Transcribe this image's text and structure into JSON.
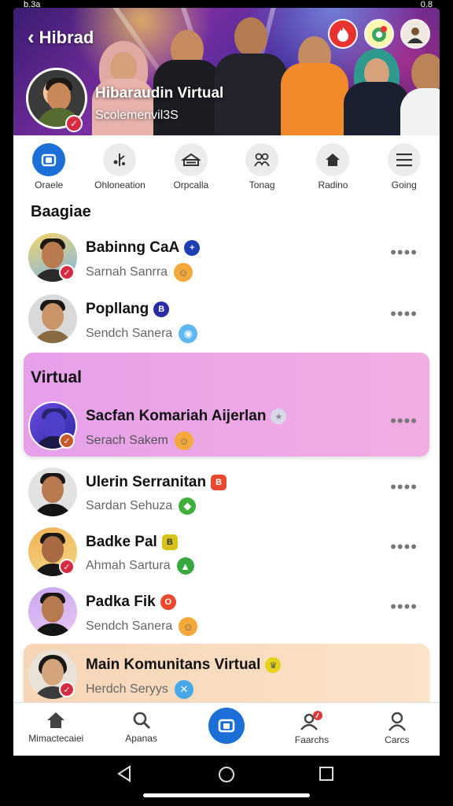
{
  "status_bar": {
    "left": "b.3a",
    "right": "0.8"
  },
  "header": {
    "back_label": "Hibrad",
    "profile_name": "Hibaraudin Virtual",
    "profile_handle": "Scolemenvil3S"
  },
  "tabs": [
    {
      "label": "Oraele",
      "icon": "camera-icon",
      "active": true
    },
    {
      "label": "Ohloneation",
      "icon": "share-icon",
      "active": false
    },
    {
      "label": "Orpcalla",
      "icon": "inbox-icon",
      "active": false
    },
    {
      "label": "Tonag",
      "icon": "group-icon",
      "active": false
    },
    {
      "label": "Radino",
      "icon": "home-icon",
      "active": false
    },
    {
      "label": "Going",
      "icon": "menu-icon",
      "active": false
    }
  ],
  "section_title": "Baagiae",
  "contacts": [
    {
      "name": "Babinng CaA",
      "sub": "Sarnah Sanrra",
      "badge_color": "#1d3fb3",
      "badge_glyph": "+",
      "emoji": "☺",
      "emoji_bg": "#f4a93a"
    },
    {
      "name": "Popllang",
      "sub": "Sendch Sanera",
      "badge_color": "#2b2ba6",
      "badge_glyph": "B",
      "emoji": "◉",
      "emoji_bg": "#5fb7f2"
    }
  ],
  "highlight_card": {
    "title": "Virtual",
    "name": "Sacfan Komariah Aijerlan",
    "sub": "Serach Sakem",
    "badge_glyph": "★",
    "emoji": "☺"
  },
  "contacts_more": [
    {
      "name": "Ulerin Serranitan",
      "sub": "Sardan Sehuza",
      "badge_color": "#e8492f",
      "badge_glyph": "B",
      "emoji": "◆",
      "emoji_bg": "#3fae3a"
    },
    {
      "name": "Badke Pal",
      "sub": "Ahmah Sartura",
      "badge_color": "#d6c21a",
      "badge_glyph": "B",
      "emoji": "▲",
      "emoji_bg": "#38a83f"
    },
    {
      "name": "Padka Fik",
      "sub": "Sendch Sanera",
      "badge_color": "#e8492f",
      "badge_glyph": "O",
      "emoji": "☺",
      "emoji_bg": "#f4a93a"
    }
  ],
  "bottom_card": {
    "name": "Main Komunitans Virtual",
    "sub": "Herdch Seryys",
    "badge_glyph": "♛",
    "emoji": "✕"
  },
  "bottom_nav": [
    {
      "label": "Mimactecaiei",
      "icon": "home-icon"
    },
    {
      "label": "Apanas",
      "icon": "search-icon"
    },
    {
      "label": "",
      "icon": "camera-icon"
    },
    {
      "label": "Faarchs",
      "icon": "profile-notification-icon"
    },
    {
      "label": "Carcs",
      "icon": "profile-icon"
    }
  ],
  "colors": {
    "accent": "#1b6fd6",
    "highlight_card_bg": "#e8a4e8",
    "bottom_card_bg": "#f8dcc0",
    "verify": "#d62b43"
  }
}
